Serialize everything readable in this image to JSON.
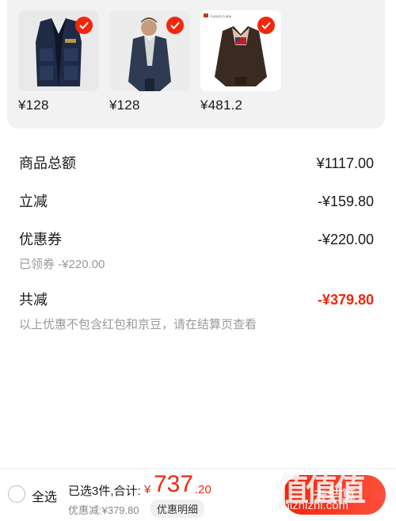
{
  "products": [
    {
      "price": "¥128",
      "image": "vest-image"
    },
    {
      "price": "¥128",
      "image": "jacket-model-image"
    },
    {
      "price": "¥481.2",
      "image": "leather-jacket-image",
      "brand_tag": "Luxury Lane"
    }
  ],
  "summary": {
    "goods_total_label": "商品总额",
    "goods_total_value": "¥1117.00",
    "instant_discount_label": "立减",
    "instant_discount_value": "-¥159.80",
    "coupon_label": "优惠券",
    "coupon_value": "-¥220.00",
    "coupon_claimed": "已领券 -¥220.00",
    "total_saving_label": "共减",
    "total_saving_value": "-¥379.80",
    "note": "以上优惠不包含红包和京豆，请在结算页查看"
  },
  "bottom_bar": {
    "select_all": "全选",
    "selected_count": "已选3件,合计:",
    "currency": "¥",
    "total_integer": "737",
    "total_decimal": ".20",
    "discount_text": "优惠减:¥379.80",
    "detail_button": "优惠明细",
    "checkout_button": "去结算"
  },
  "watermark": {
    "big": "值值值",
    "small": "zhizhizhi.com"
  },
  "colors": {
    "accent": "#f2270c",
    "card_bg": "#f2f2f2",
    "muted": "#999999"
  }
}
